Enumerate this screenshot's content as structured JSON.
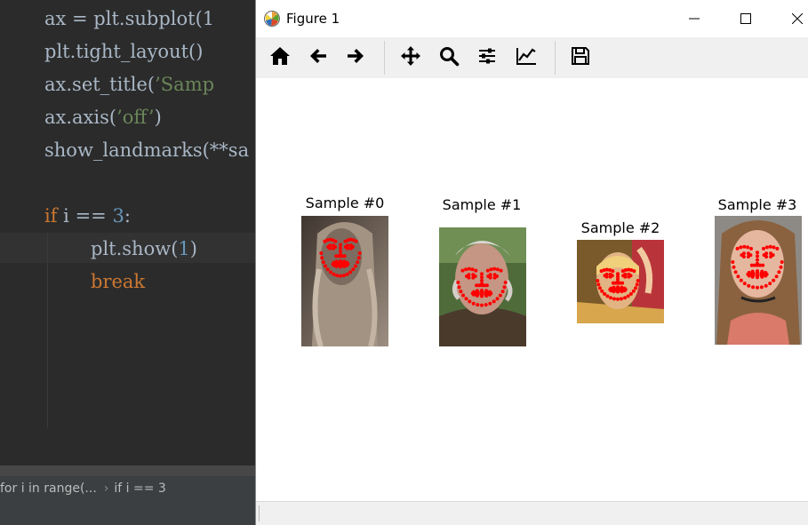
{
  "editor": {
    "lines": {
      "l1": {
        "a": "ax = plt.subplot(1"
      },
      "l2": {
        "a": "plt.tight_layout()"
      },
      "l3": {
        "a": "ax.set_title(",
        "b": "’Samp"
      },
      "l4": {
        "a": "ax.axis(",
        "b": "’off’",
        "c": ")"
      },
      "l5": {
        "a": "show_landmarks(**sa"
      },
      "l7": {
        "kw": "if",
        "a": " i == ",
        "num": "3",
        "b": ":"
      },
      "l8": {
        "a": "plt.show(",
        "num": "1",
        "b": ")"
      },
      "l9": {
        "kw": "break"
      }
    },
    "breadcrumb": {
      "first": "for i in range(...",
      "separator": "›",
      "second": "if i == 3"
    }
  },
  "window": {
    "title": "Figure 1"
  },
  "toolbar": {
    "tools": [
      "home-icon",
      "back-arrow-icon",
      "forward-arrow-icon",
      "pan-move-icon",
      "zoom-magnifier-icon",
      "configure-subplots-icon",
      "edit-axis-icon",
      "save-floppy-icon"
    ]
  },
  "figure": {
    "samples": [
      {
        "title": "Sample #0"
      },
      {
        "title": "Sample #1"
      },
      {
        "title": "Sample #2"
      },
      {
        "title": "Sample #3"
      }
    ],
    "landmark_color": "#ff0000"
  },
  "colors": {
    "editor_bg": "#2b2b2b",
    "keyword": "#cc7832",
    "string": "#6a8759",
    "number": "#6897bb",
    "code_text": "#a9b7c6"
  }
}
